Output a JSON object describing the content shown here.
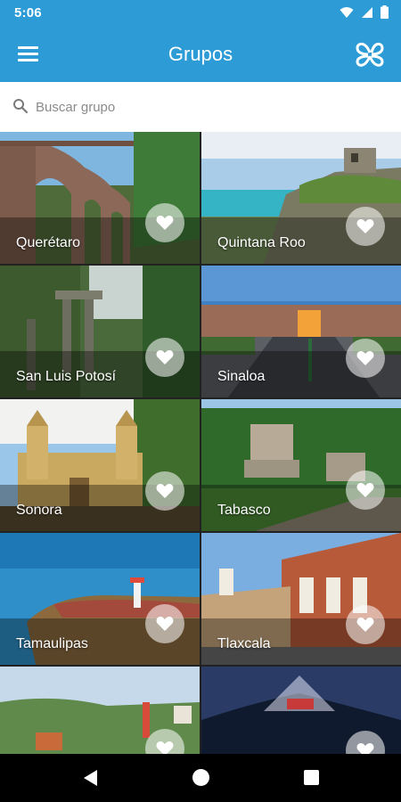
{
  "status_bar": {
    "time": "5:06",
    "icons": [
      "wifi-icon",
      "signal-icon",
      "battery-icon"
    ]
  },
  "app_bar": {
    "title": "Grupos",
    "menu_icon": "hamburger-menu-icon",
    "logo_icon": "clover-logo-icon"
  },
  "search": {
    "placeholder": "Buscar grupo",
    "value": "",
    "icon": "search-icon"
  },
  "groups": [
    {
      "name": "Querétaro"
    },
    {
      "name": "Quintana Roo"
    },
    {
      "name": "San Luis Potosí"
    },
    {
      "name": "Sinaloa"
    },
    {
      "name": "Sonora"
    },
    {
      "name": "Tabasco"
    },
    {
      "name": "Tamaulipas"
    },
    {
      "name": "Tlaxcala"
    },
    {
      "name": ""
    },
    {
      "name": ""
    }
  ],
  "colors": {
    "primary": "#2c9bd6",
    "search_bg": "#ffffff",
    "nav_bar": "#000000"
  },
  "nav_bar": {
    "buttons": [
      "back-icon",
      "home-icon",
      "recents-icon"
    ]
  }
}
